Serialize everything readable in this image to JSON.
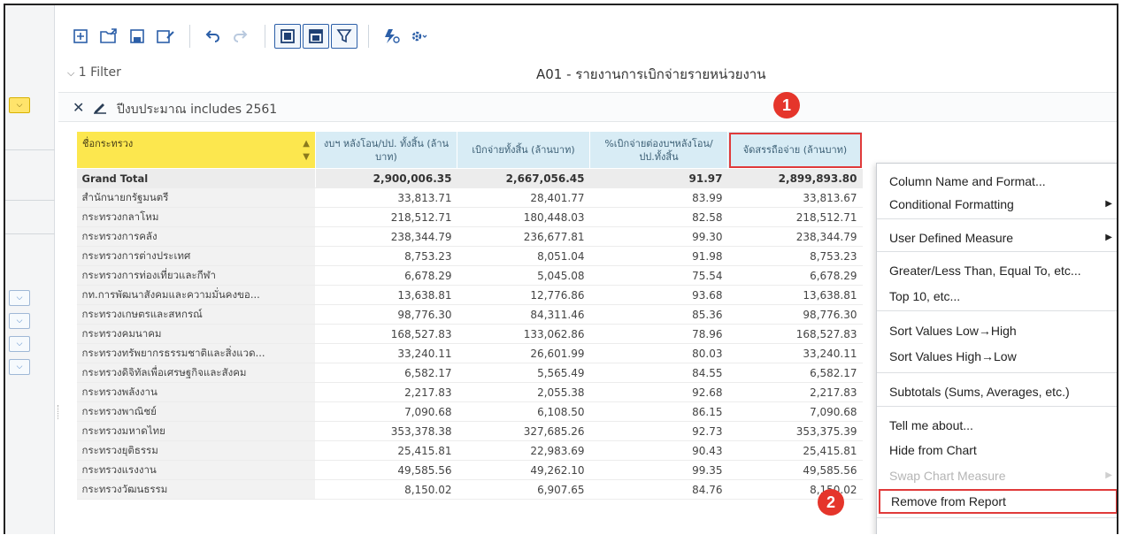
{
  "toolbar": {
    "icons": [
      "new-icon",
      "open-icon",
      "save-icon",
      "save-as-icon",
      "undo-icon",
      "redo-icon",
      "table-view-icon",
      "table-layout-icon",
      "filter-icon",
      "refresh-icon",
      "settings-icon"
    ]
  },
  "filter": {
    "toggle_label": "1 Filter",
    "condition": "ปีงบประมาณ includes 2561"
  },
  "report_title": "A01 - รายงานการเบิกจ่ายรายหน่วยงาน",
  "badges": {
    "one": "1",
    "two": "2"
  },
  "table": {
    "headers": [
      "ชื่อกระทรวง",
      "งบฯ หลังโอน/ปป. ทั้งสิ้น (ล้านบาท)",
      "เบิกจ่ายทั้งสิ้น (ล้านบาท)",
      "%เบิกจ่ายต่องบฯหลังโอน/ปป.ทั้งสิ้น",
      "จัดสรรถือจ่าย (ล้านบาท)"
    ],
    "grand_total": [
      "Grand Total",
      "2,900,006.35",
      "2,667,056.45",
      "91.97",
      "2,899,893.80"
    ],
    "rows": [
      [
        "สำนักนายกรัฐมนตรี",
        "33,813.71",
        "28,401.77",
        "83.99",
        "33,813.67"
      ],
      [
        "กระทรวงกลาโหม",
        "218,512.71",
        "180,448.03",
        "82.58",
        "218,512.71"
      ],
      [
        "กระทรวงการคลัง",
        "238,344.79",
        "236,677.81",
        "99.30",
        "238,344.79"
      ],
      [
        "กระทรวงการต่างประเทศ",
        "8,753.23",
        "8,051.04",
        "91.98",
        "8,753.23"
      ],
      [
        "กระทรวงการท่องเที่ยวและกีฬา",
        "6,678.29",
        "5,045.08",
        "75.54",
        "6,678.29"
      ],
      [
        "กท.การพัฒนาสังคมและความมั่นคงขอ...",
        "13,638.81",
        "12,776.86",
        "93.68",
        "13,638.81"
      ],
      [
        "กระทรวงเกษตรและสหกรณ์",
        "98,776.30",
        "84,311.46",
        "85.36",
        "98,776.30"
      ],
      [
        "กระทรวงคมนาคม",
        "168,527.83",
        "133,062.86",
        "78.96",
        "168,527.83"
      ],
      [
        "กระทรวงทรัพยากรธรรมชาติและสิ่งแวด...",
        "33,240.11",
        "26,601.99",
        "80.03",
        "33,240.11"
      ],
      [
        "กระทรวงดิจิทัลเพื่อเศรษฐกิจและสังคม",
        "6,582.17",
        "5,565.49",
        "84.55",
        "6,582.17"
      ],
      [
        "กระทรวงพลังงาน",
        "2,217.83",
        "2,055.38",
        "92.68",
        "2,217.83"
      ],
      [
        "กระทรวงพาณิชย์",
        "7,090.68",
        "6,108.50",
        "86.15",
        "7,090.68"
      ],
      [
        "กระทรวงมหาดไทย",
        "353,378.38",
        "327,685.26",
        "92.73",
        "353,375.39"
      ],
      [
        "กระทรวงยุติธรรม",
        "25,415.81",
        "22,983.69",
        "90.43",
        "25,415.81"
      ],
      [
        "กระทรวงแรงงาน",
        "49,585.56",
        "49,262.10",
        "99.35",
        "49,585.56"
      ],
      [
        "กระทรวงวัฒนธรรม",
        "8,150.02",
        "6,907.65",
        "84.76",
        "8,150.02"
      ]
    ]
  },
  "context_menu": {
    "items": [
      {
        "label": "Column Name and Format...",
        "submenu": false,
        "disabled": false
      },
      {
        "label": "Conditional Formatting",
        "submenu": true,
        "disabled": false
      },
      {
        "label": "User Defined Measure",
        "submenu": true,
        "disabled": false
      },
      {
        "label": "Greater/Less Than, Equal To, etc...",
        "submenu": false,
        "disabled": false
      },
      {
        "label": "Top 10, etc...",
        "submenu": false,
        "disabled": false
      },
      {
        "label": "Sort Values Low→High",
        "submenu": false,
        "disabled": false
      },
      {
        "label": "Sort Values High→Low",
        "submenu": false,
        "disabled": false
      },
      {
        "label": "Subtotals (Sums, Averages, etc.)",
        "submenu": false,
        "disabled": false
      },
      {
        "label": "Tell me about...",
        "submenu": false,
        "disabled": false
      },
      {
        "label": "Hide from Chart",
        "submenu": false,
        "disabled": false
      },
      {
        "label": "Swap Chart Measure",
        "submenu": true,
        "disabled": true
      },
      {
        "label": "Remove from Report",
        "submenu": false,
        "disabled": false
      }
    ]
  },
  "colors": {
    "accent": "#2c5fa8",
    "header_blue": "#d8ecf5",
    "header_yellow": "#fce74e",
    "highlight_red": "#e03a3a"
  }
}
